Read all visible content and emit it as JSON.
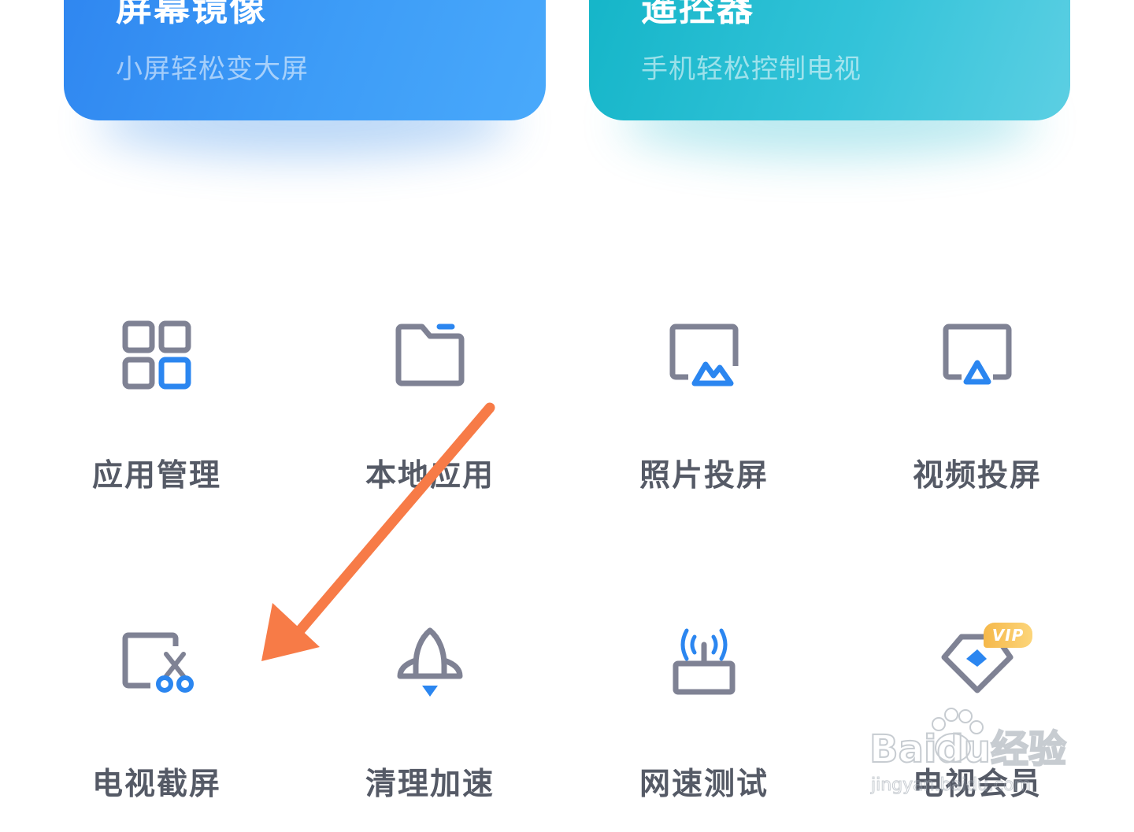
{
  "cards": [
    {
      "title": "屏幕镜像",
      "subtitle": "小屏轻松变大屏",
      "color": "#3d9cf7"
    },
    {
      "title": "遥控器",
      "subtitle": "手机轻松控制电视",
      "color": "#33c3d9"
    }
  ],
  "tiles": [
    {
      "label": "应用管理",
      "icon": "app-grid-icon"
    },
    {
      "label": "本地应用",
      "icon": "folder-icon"
    },
    {
      "label": "照片投屏",
      "icon": "photo-cast-icon"
    },
    {
      "label": "视频投屏",
      "icon": "video-cast-icon"
    },
    {
      "label": "电视截屏",
      "icon": "tv-screenshot-icon"
    },
    {
      "label": "清理加速",
      "icon": "rocket-icon"
    },
    {
      "label": "网速测试",
      "icon": "router-icon"
    },
    {
      "label": "电视会员",
      "icon": "vip-diamond-icon"
    }
  ],
  "vip_badge": "VIP",
  "watermark": {
    "brand": "Baidu经验",
    "url": "jingyan.baidu.com"
  },
  "colors": {
    "icon_gray": "#7f8294",
    "icon_blue": "#2b86f0",
    "arrow": "#f77b47",
    "vip_gold": "#f5b84a"
  }
}
